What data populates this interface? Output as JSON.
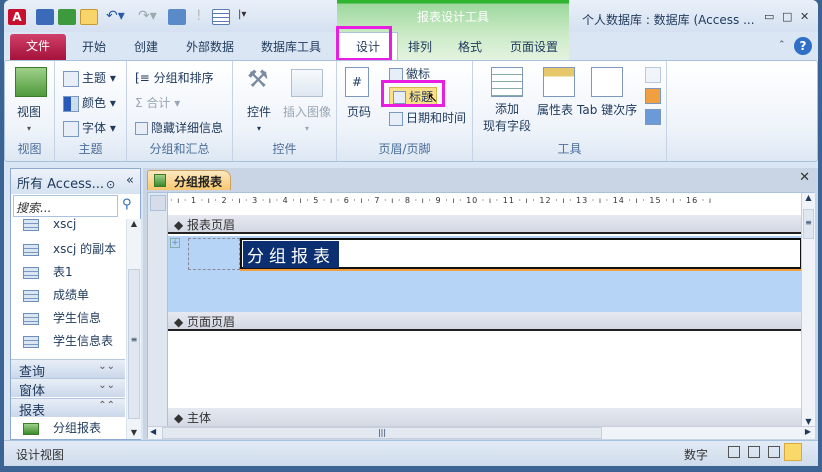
{
  "window": {
    "title": "个人数据库 : 数据库 (Access ...",
    "context_group": "报表设计工具"
  },
  "ribbon_tabs": [
    "文件",
    "开始",
    "创建",
    "外部数据",
    "数据库工具",
    "设计",
    "排列",
    "格式",
    "页面设置"
  ],
  "groups": {
    "view": {
      "label": "视图",
      "button": "视图"
    },
    "theme": {
      "label": "主题",
      "items": [
        "主题",
        "颜色",
        "字体"
      ]
    },
    "grouping": {
      "label": "分组和汇总",
      "items": [
        "分组和排序",
        "合计",
        "隐藏详细信息"
      ]
    },
    "controls": {
      "label": "控件",
      "items": [
        "控件",
        "插入图像"
      ]
    },
    "header_footer": {
      "label": "页眉/页脚",
      "items": [
        "页码",
        "徽标",
        "标题",
        "日期和时间"
      ]
    },
    "tools": {
      "label": "工具",
      "items": [
        "添加",
        "现有字段",
        "属性表",
        "Tab 键次序"
      ]
    }
  },
  "nav": {
    "header": "所有 Access...",
    "search_placeholder": "搜索...",
    "tables": [
      "xscj",
      "xscj 的副本",
      "表1",
      "成绩单",
      "学生信息",
      "学生信息表"
    ],
    "categories": [
      "查询",
      "窗体",
      "报表"
    ],
    "reports": [
      "分组报表"
    ]
  },
  "document": {
    "tab": "分组报表",
    "ruler": "· ı · 1 · ı · 2 · ı · 3 · ı · 4 · ı · 5 · ı · 6 · ı · 7 · ı · 8 · ı · 9 · ı · 10 · ı · 11 · ı · 12 · ı · 13 · ı · 14 · ı · 15 · ı · 16 · ı",
    "sections": [
      "报表页眉",
      "页面页眉",
      "主体"
    ],
    "title_label": "分组报表"
  },
  "status": {
    "left": "设计视图",
    "right": "数字"
  }
}
